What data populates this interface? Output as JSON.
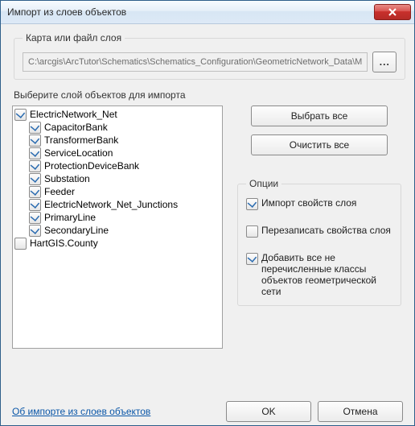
{
  "window": {
    "title": "Импорт из слоев объектов"
  },
  "map_group": {
    "legend": "Карта или файл слоя",
    "path": "C:\\arcgis\\ArcTutor\\Schematics\\Schematics_Configuration\\GeometricNetwork_Data\\M",
    "browse_label": "..."
  },
  "layers": {
    "label": "Выберите слой объектов для импорта",
    "items": [
      {
        "label": "ElectricNetwork_Net",
        "checked": true,
        "child": false
      },
      {
        "label": "CapacitorBank",
        "checked": true,
        "child": true
      },
      {
        "label": "TransformerBank",
        "checked": true,
        "child": true
      },
      {
        "label": "ServiceLocation",
        "checked": true,
        "child": true
      },
      {
        "label": "ProtectionDeviceBank",
        "checked": true,
        "child": true
      },
      {
        "label": "Substation",
        "checked": true,
        "child": true
      },
      {
        "label": "Feeder",
        "checked": true,
        "child": true
      },
      {
        "label": "ElectricNetwork_Net_Junctions",
        "checked": true,
        "child": true
      },
      {
        "label": "PrimaryLine",
        "checked": true,
        "child": true
      },
      {
        "label": "SecondaryLine",
        "checked": true,
        "child": true
      },
      {
        "label": "HartGIS.County",
        "checked": false,
        "child": false
      }
    ]
  },
  "buttons": {
    "select_all": "Выбрать все",
    "clear_all": "Очистить все",
    "ok": "OK",
    "cancel": "Отмена"
  },
  "options": {
    "legend": "Опции",
    "items": [
      {
        "label": "Импорт свойств слоя",
        "checked": true
      },
      {
        "label": "Перезаписать свойства слоя",
        "checked": false
      },
      {
        "label": "Добавить все не перечисленные классы объектов геометрической сети",
        "checked": true
      }
    ]
  },
  "help": {
    "label": "Об импорте из слоев объектов"
  }
}
